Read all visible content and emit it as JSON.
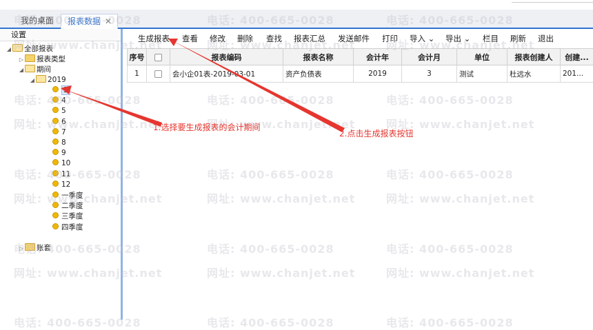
{
  "tabs": [
    {
      "label": "我的桌面"
    },
    {
      "label": "报表数据",
      "close": "✕"
    }
  ],
  "left_panel": {
    "header": "设置",
    "tree": {
      "root": "全部报表",
      "report_type": "报表类型",
      "period": "期间",
      "year": "2019",
      "months": [
        "3",
        "4",
        "5",
        "6",
        "7",
        "8",
        "9",
        "10",
        "11",
        "12"
      ],
      "quarters": [
        "一季度",
        "二季度",
        "三季度",
        "四季度"
      ],
      "account_set": "账套"
    }
  },
  "toolbar": {
    "items": [
      "生成报表",
      "查看",
      "修改",
      "删除",
      "查找",
      "报表汇总",
      "发送邮件",
      "打印",
      "导入",
      "导出",
      "栏目",
      "刷新",
      "退出"
    ]
  },
  "table": {
    "headers": [
      "序号",
      "",
      "报表编码",
      "报表名称",
      "会计年",
      "会计月",
      "单位",
      "报表创建人",
      "创建..."
    ],
    "rows": [
      [
        "1",
        "",
        "会小企01表-2019-03-01",
        "资产负债表",
        "2019",
        "3",
        "测试",
        "杜远水",
        "201..."
      ]
    ]
  },
  "annotations": {
    "step1": "1.选择要生成报表的会计期间",
    "step2": "2.点击生成报表按钮",
    "color": "#e5362f"
  },
  "watermarks": {
    "phone": "电话: 400-665-0028",
    "site": "网址: www.chanjet.net"
  }
}
